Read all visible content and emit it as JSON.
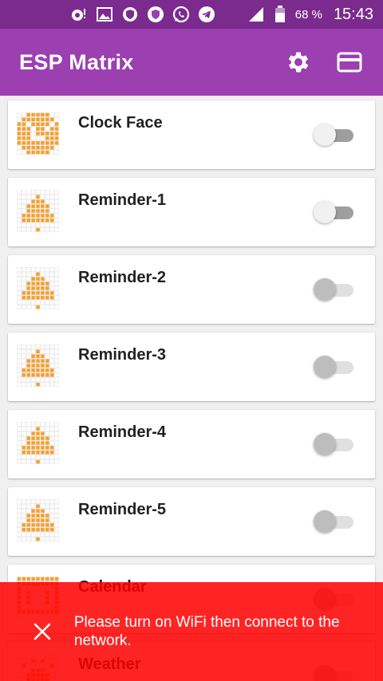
{
  "status_bar": {
    "battery": "68 %",
    "time": "15:43",
    "icons": [
      "notification-icon",
      "image-icon",
      "shield-icon",
      "vpn-icon",
      "whatsapp-icon",
      "telegram-icon",
      "signal-icon",
      "battery-icon"
    ]
  },
  "app_bar": {
    "title": "ESP Matrix",
    "actions": [
      "settings-icon",
      "card-icon"
    ]
  },
  "items": [
    {
      "title": "Clock Face",
      "icon": "clock-matrix-icon",
      "switch_on": false
    },
    {
      "title": "Reminder-1",
      "icon": "bell-matrix-icon",
      "switch_on": false
    },
    {
      "title": "Reminder-2",
      "icon": "bell-matrix-icon",
      "switch_on": false
    },
    {
      "title": "Reminder-3",
      "icon": "bell-matrix-icon",
      "switch_on": false
    },
    {
      "title": "Reminder-4",
      "icon": "bell-matrix-icon",
      "switch_on": false
    },
    {
      "title": "Reminder-5",
      "icon": "bell-matrix-icon",
      "switch_on": false
    },
    {
      "title": "Calendar",
      "icon": "calendar-matrix-icon",
      "switch_on": false
    },
    {
      "title": "Weather",
      "icon": "weather-matrix-icon",
      "switch_on": false
    }
  ],
  "snackbar": {
    "message": "Please turn on WiFi then connect to the network."
  },
  "colors": {
    "status_bar": "#7b2a8e",
    "app_bar": "#9c3fb1",
    "matrix_on": "#f7a02a",
    "snackbar": "#ff0000"
  }
}
